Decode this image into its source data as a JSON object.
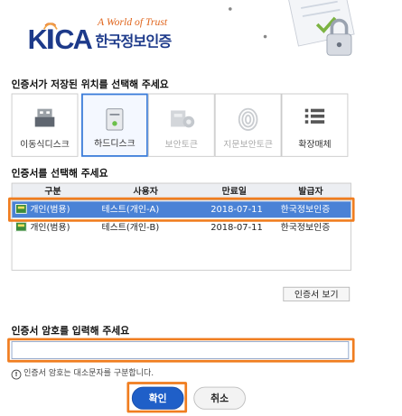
{
  "header": {
    "logo_text": "KICA",
    "tagline": "A World of Trust",
    "brand_kr": "한국정보인증"
  },
  "storage": {
    "title": "인증서가 저장된 위치를 선택해 주세요",
    "items": [
      {
        "label": "이동식디스크",
        "state": "enabled"
      },
      {
        "label": "하드디스크",
        "state": "selected"
      },
      {
        "label": "보안토큰",
        "state": "disabled"
      },
      {
        "label": "지문보안토큰",
        "state": "disabled"
      },
      {
        "label": "확장매체",
        "state": "enabled"
      }
    ]
  },
  "certs": {
    "title": "인증서를 선택해 주세요",
    "columns": [
      "구분",
      "사용자",
      "만료일",
      "발급자"
    ],
    "rows": [
      {
        "type": "개인(범용)",
        "user": "테스트(개인-A)",
        "expiry": "2018-07-11",
        "issuer": "한국정보인증",
        "selected": true
      },
      {
        "type": "개인(범용)",
        "user": "테스트(개인-B)",
        "expiry": "2018-07-11",
        "issuer": "한국정보인증",
        "selected": false
      }
    ],
    "view_button": "인증서 보기"
  },
  "password": {
    "title": "인증서 암호를 입력해 주세요",
    "value": "",
    "notice": "인증서 암호는 대소문자를 구분합니다."
  },
  "buttons": {
    "ok": "확인",
    "cancel": "취소"
  },
  "colors": {
    "accent": "#4a82d6",
    "highlight": "#f07d1f",
    "brand_blue": "#1d3a8a",
    "brand_orange": "#e0661e"
  }
}
